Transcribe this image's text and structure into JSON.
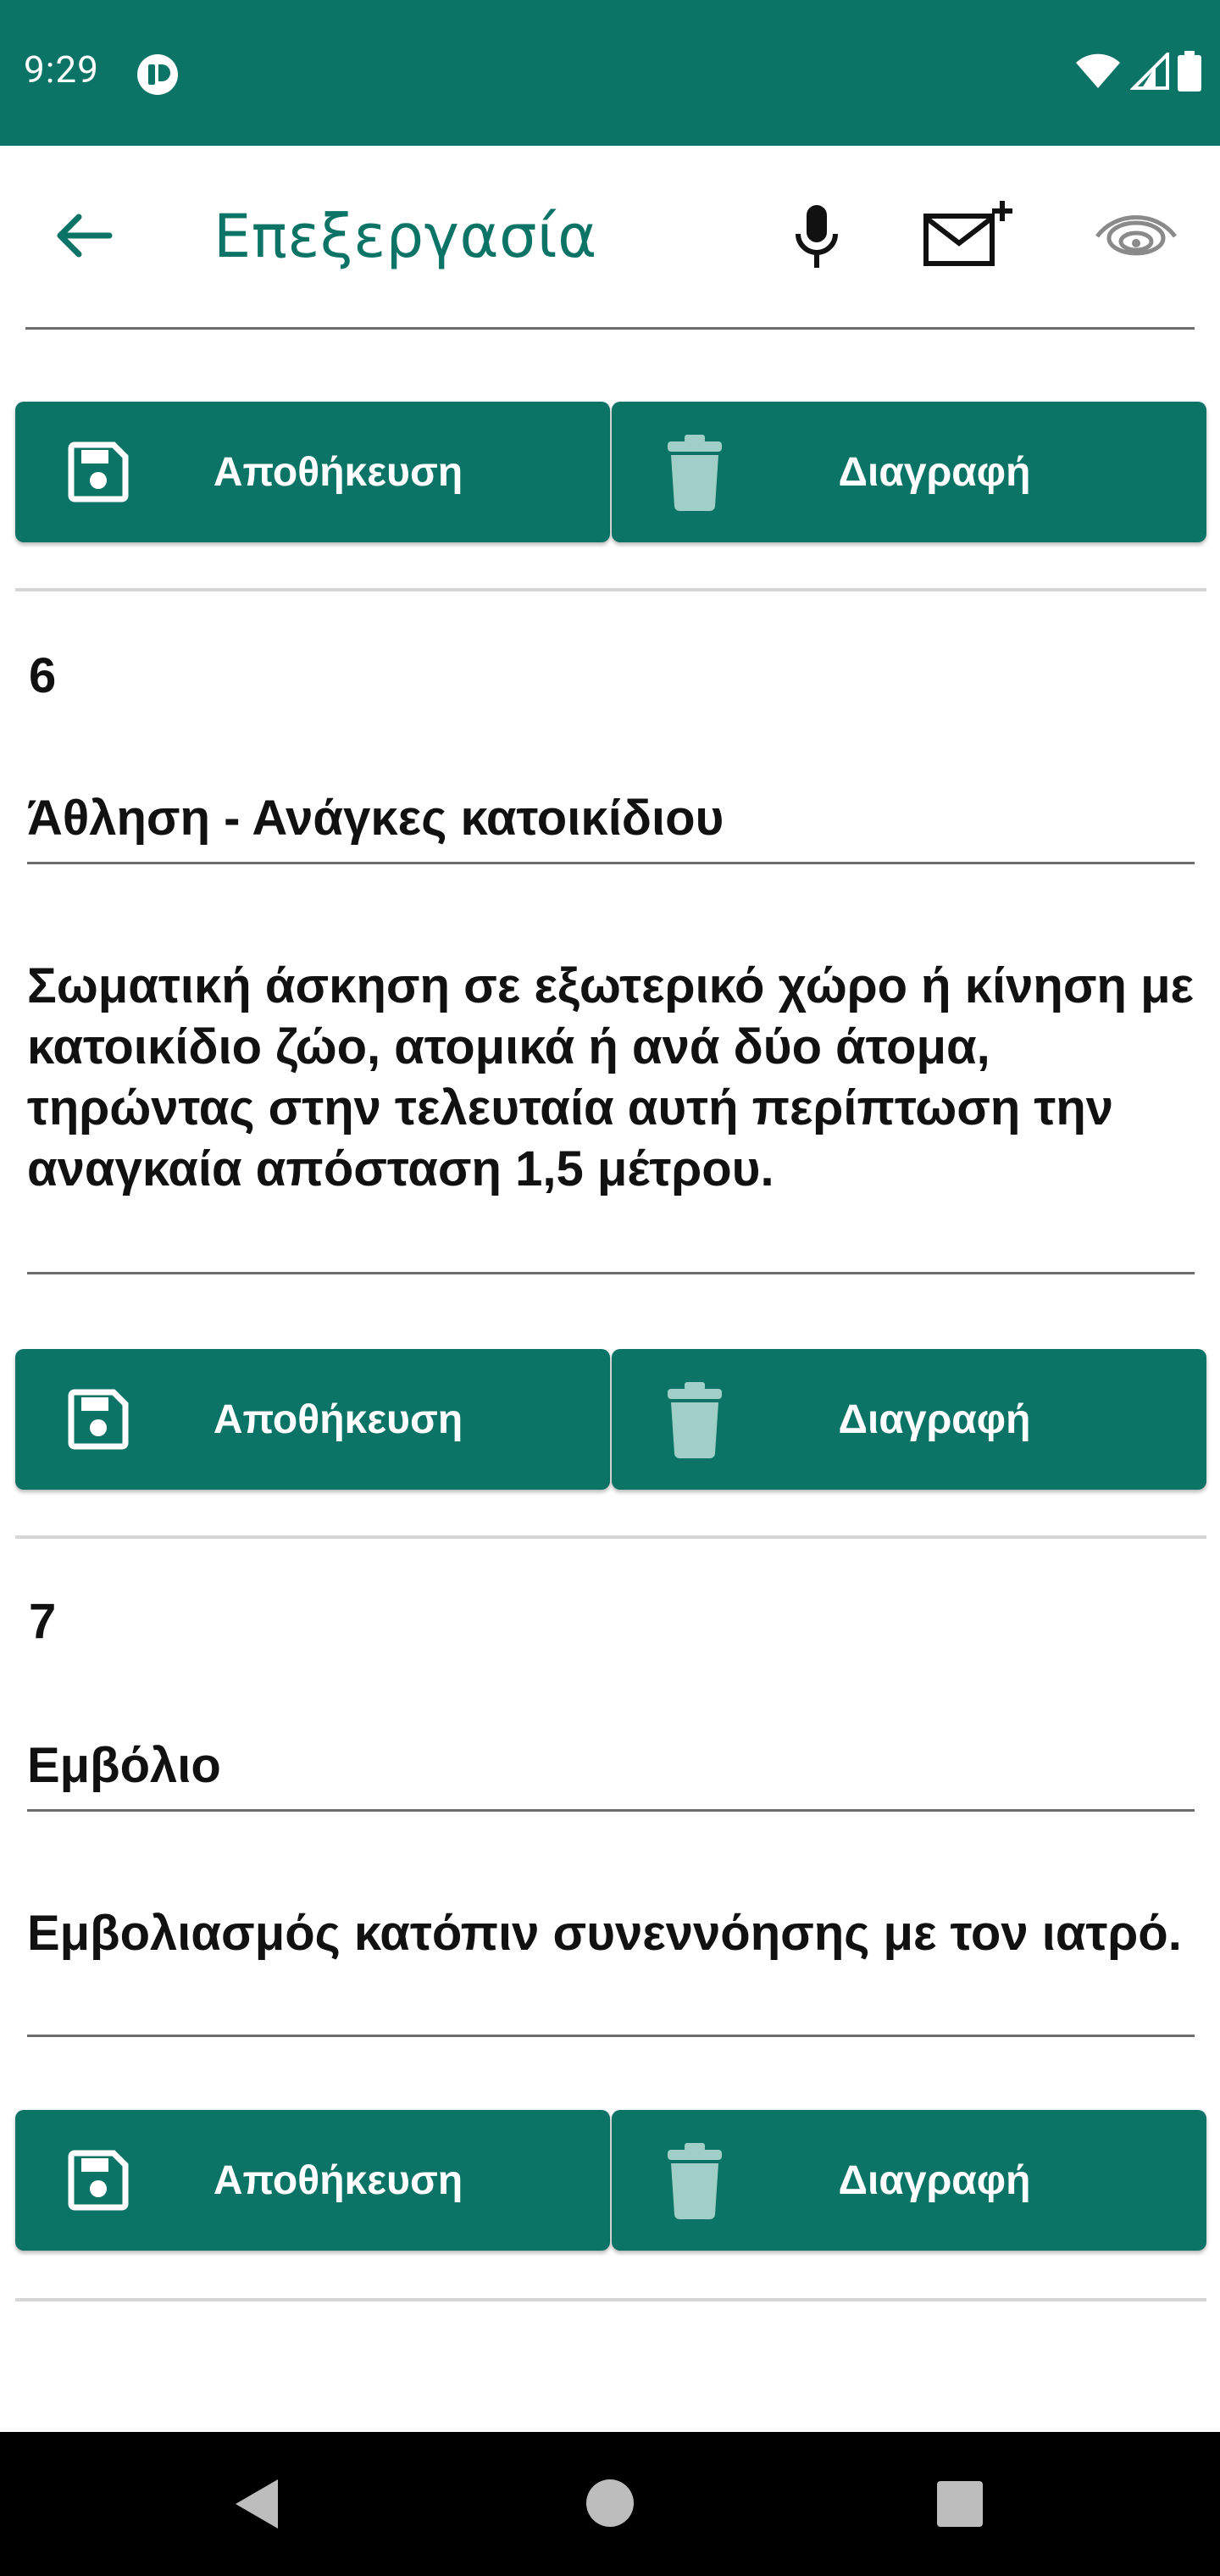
{
  "status_bar": {
    "time": "9:29",
    "app_icon": "app-notification-icon",
    "wifi_icon": "wifi-icon",
    "signal_icon": "signal-icon",
    "battery_icon": "battery-icon"
  },
  "app_bar": {
    "title": "Επεξεργασία",
    "back_icon": "arrow-left-icon",
    "mic_icon": "microphone-icon",
    "mail_icon": "mail-plus-icon",
    "eye_icon": "eye-icon"
  },
  "buttons": {
    "save_label": "Αποθήκευση",
    "delete_label": "Διαγραφή"
  },
  "entries": [
    {
      "number": "6",
      "title": "Άθληση - Ανάγκες κατοικίδιου",
      "description": "Σωματική άσκηση σε εξωτερικό χώρο ή κίνηση με κατοικίδιο ζώο, ατομικά ή ανά δύο άτομα, τηρώντας στην τελευταία αυτή περίπτωση την αναγκαία απόσταση 1,5 μέτρου."
    },
    {
      "number": "7",
      "title": "Εμβόλιο",
      "description": "Εμβολιασμός κατόπιν συνεννόησης με τον ιατρό."
    }
  ],
  "colors": {
    "primary": "#0b7467",
    "delete_icon": "#9fcfc6",
    "divider": "#6c6c6c"
  }
}
